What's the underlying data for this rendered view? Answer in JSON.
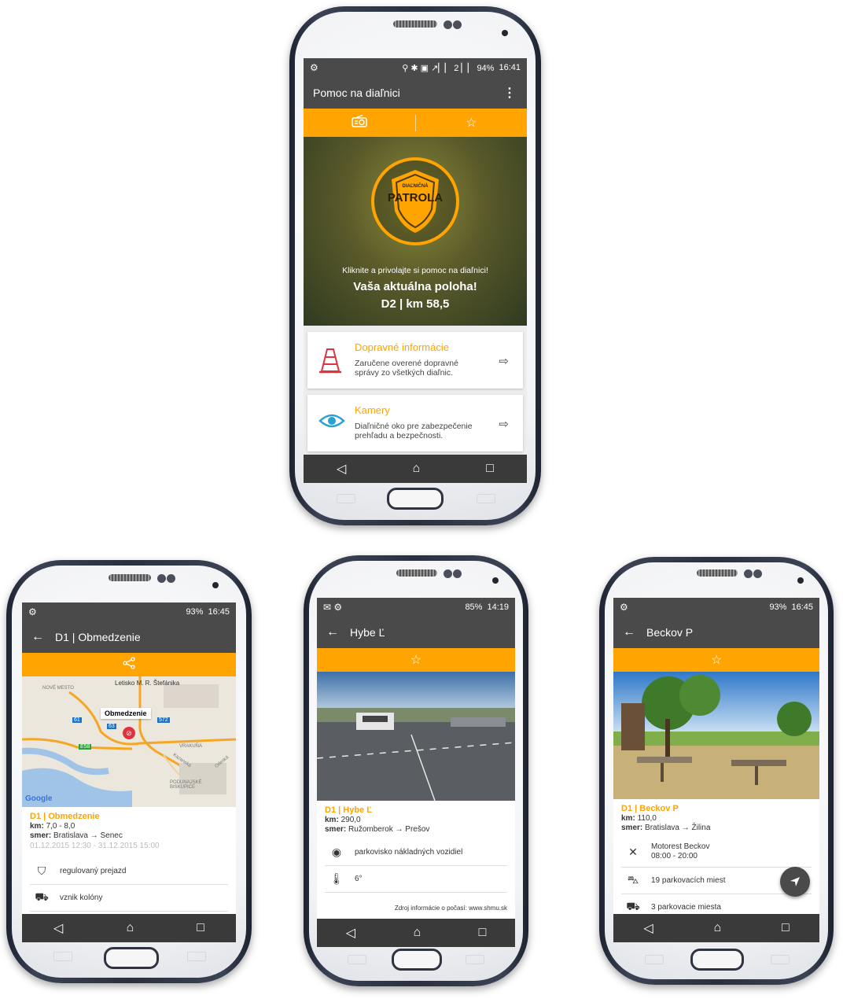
{
  "phone_top": {
    "status": {
      "left_icon": "⚙",
      "icons": "⚲ ✱ ▣ ↗▏▏ 2 ▏▏ 94%",
      "time": "16:41"
    },
    "title": "Pomoc na diaľnici",
    "tab_radio_icon": "radio-icon",
    "tab_star_icon": "star-icon",
    "badge_small": "DIAĽNIČNÁ",
    "badge_big": "PATROLA",
    "hero_hint": "Kliknite a privolajte si pomoc na diaľnici!",
    "hero_location_label": "Vaša aktuálna poloha!",
    "hero_location_value": "D2 | km 58,5",
    "card1_title": "Dopravné informácie",
    "card1_desc": "Zaručene overené dopravné správy zo všetkých diaľnic.",
    "card2_title": "Kamery",
    "card2_desc": "Diaľničné oko pre zabezpečenie prehľadu a bezpečnosti."
  },
  "phone_left": {
    "status_time": "16:45",
    "status_battery": "93%",
    "title": "D1 | Obmedzenie",
    "map_label_airport": "Letisko M. R. Štefánika",
    "map_label_popup": "Obmedzenie",
    "map_label_mesto": "NOVÉ MESTO",
    "map_label_vrakuna": "VRAKUŇA",
    "map_label_podunajske": "PODUNAJSKÉ BISKUPICE",
    "map_label_kazanska": "Kazanská",
    "map_label_odeska": "Odeská",
    "map_badge_61": "61",
    "map_badge_63": "63",
    "map_badge_572": "572",
    "map_badge_e58": "E58",
    "google": "Google",
    "heading": "D1 | Obmedzenie",
    "km_label": "km:",
    "km_value": "7,0 - 8,0",
    "smer_label": "smer:",
    "smer_value": "Bratislava → Senec",
    "dates": "01.12.2015 12:30 - 31.12.2015 15:00",
    "row1": "regulovaný prejazd",
    "row2": "vznik kolóny"
  },
  "phone_mid": {
    "status_time": "14:19",
    "status_battery": "85%",
    "title": "Hybe Ľ",
    "heading": "D1 | Hybe Ľ",
    "km_label": "km:",
    "km_value": "290,0",
    "smer_label": "smer:",
    "smer_value": "Ružomberok → Prešov",
    "row1": "parkovisko nákladných vozidiel",
    "row2": "6°",
    "source": "Zdroj informácie o počasí: www.shmu.sk"
  },
  "phone_right": {
    "status_time": "16:45",
    "status_battery": "93%",
    "title": "Beckov P",
    "heading": "D1 | Beckov P",
    "km_label": "km:",
    "km_value": "110,0",
    "smer_label": "smer:",
    "smer_value": "Bratislava → Žilina",
    "row1_title": "Motorest Beckov",
    "row1_hours": "08:00 - 20:00",
    "row2": "19 parkovacích miest",
    "row3": "3 parkovacie miesta"
  },
  "colors": {
    "accent": "#ffa400",
    "bar": "#4a4a4a",
    "nav": "#3a3a3a"
  }
}
